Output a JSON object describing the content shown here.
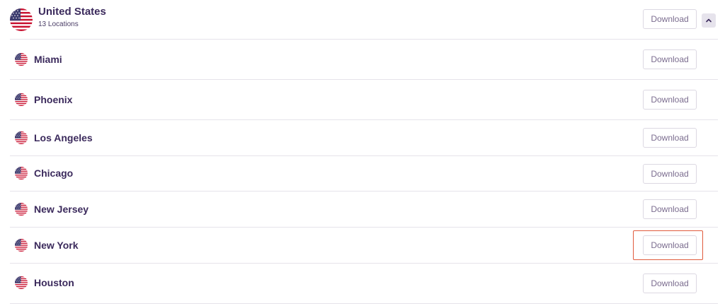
{
  "country": {
    "name": "United States",
    "subtitle": "13 Locations",
    "flag_icon": "us-flag-icon",
    "download_label": "Download",
    "collapse_icon": "chevron-up-icon"
  },
  "cities": [
    {
      "name": "Miami",
      "download_label": "Download"
    },
    {
      "name": "Phoenix",
      "download_label": "Download"
    },
    {
      "name": "Los Angeles",
      "download_label": "Download"
    },
    {
      "name": "Chicago",
      "download_label": "Download"
    },
    {
      "name": "New Jersey",
      "download_label": "Download"
    },
    {
      "name": "New York",
      "download_label": "Download"
    },
    {
      "name": "Houston",
      "download_label": "Download"
    }
  ],
  "colors": {
    "text": "#3b2a5c",
    "button_text": "#7b6d8f",
    "divider": "#e6e3ea",
    "highlight": "#e05a3c",
    "flag_red": "#c8102e",
    "flag_blue": "#3c3b6e"
  }
}
